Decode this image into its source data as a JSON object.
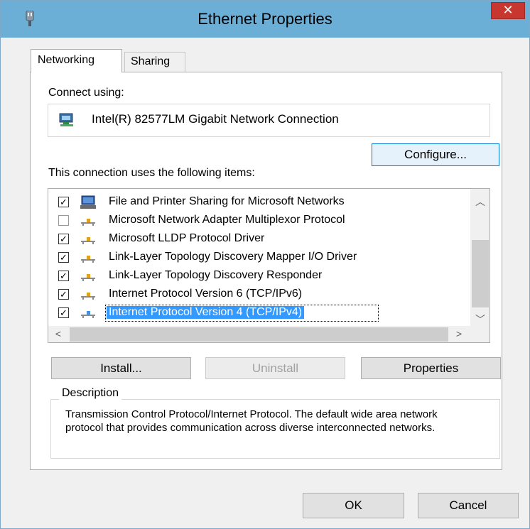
{
  "window": {
    "title": "Ethernet Properties",
    "close_label": "✕"
  },
  "tabs": [
    {
      "label": "Networking",
      "active": true
    },
    {
      "label": "Sharing",
      "active": false
    }
  ],
  "connect_using_label": "Connect using:",
  "adapter_name": "Intel(R) 82577LM Gigabit Network Connection",
  "configure_label": "Configure...",
  "items_label": "This connection uses the following items:",
  "items": [
    {
      "label": "File and Printer Sharing for Microsoft Networks",
      "checked": true,
      "icon": "computer-icon"
    },
    {
      "label": "Microsoft Network Adapter Multiplexor Protocol",
      "checked": false,
      "icon": "protocol-icon"
    },
    {
      "label": "Microsoft LLDP Protocol Driver",
      "checked": true,
      "icon": "protocol-icon"
    },
    {
      "label": "Link-Layer Topology Discovery Mapper I/O Driver",
      "checked": true,
      "icon": "protocol-icon"
    },
    {
      "label": "Link-Layer Topology Discovery Responder",
      "checked": true,
      "icon": "protocol-icon"
    },
    {
      "label": "Internet Protocol Version 6 (TCP/IPv6)",
      "checked": true,
      "icon": "protocol-icon"
    },
    {
      "label": "Internet Protocol Version 4 (TCP/IPv4)",
      "checked": true,
      "icon": "protocol-icon",
      "selected": true
    }
  ],
  "buttons": {
    "install": "Install...",
    "uninstall": "Uninstall",
    "properties": "Properties",
    "ok": "OK",
    "cancel": "Cancel"
  },
  "description": {
    "title": "Description",
    "text": "Transmission Control Protocol/Internet Protocol. The default wide area network protocol that provides communication across diverse interconnected networks."
  },
  "colors": {
    "titlebar": "#6baed6",
    "close": "#c7372f",
    "selection": "#3399ff"
  }
}
